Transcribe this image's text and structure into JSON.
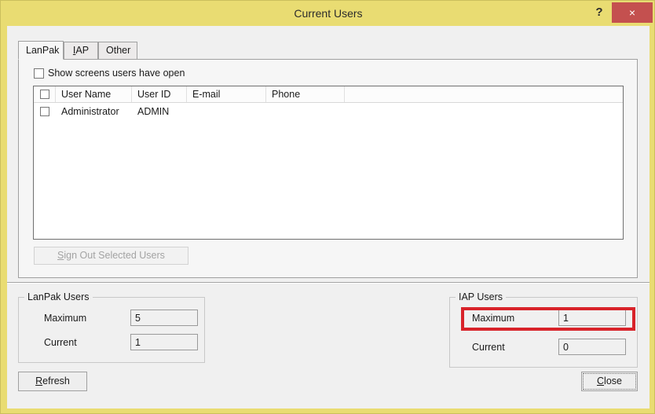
{
  "window": {
    "title": "Current Users",
    "help_label": "?",
    "close_label": "×",
    "frame_color": "#e9dc72",
    "close_button_color": "#c4504f"
  },
  "tabs": [
    {
      "label": "LanPak",
      "active": true
    },
    {
      "label": "IAP",
      "accelerator": "I",
      "active": false
    },
    {
      "label": "Other",
      "active": false
    }
  ],
  "tabpanel": {
    "show_screens": {
      "label": "Show screens users have open",
      "checked": false
    },
    "list": {
      "columns": [
        "",
        "User Name",
        "User ID",
        "E-mail",
        "Phone",
        ""
      ],
      "rows": [
        {
          "checked": false,
          "user_name": "Administrator",
          "user_id": "ADMIN",
          "email": "",
          "phone": ""
        }
      ]
    },
    "sign_out_button": {
      "label": "Sign Out Selected Users",
      "accelerator": "S",
      "enabled": false
    }
  },
  "groups": {
    "lanpak": {
      "legend": "LanPak Users",
      "maximum_label": "Maximum",
      "maximum_value": "5",
      "current_label": "Current",
      "current_value": "1"
    },
    "iap": {
      "legend": "IAP Users",
      "maximum_label": "Maximum",
      "maximum_value": "1",
      "current_label": "Current",
      "current_value": "0"
    }
  },
  "annotation": {
    "color": "#d8232a",
    "target": "IAP Users Maximum"
  },
  "buttons": {
    "refresh": {
      "label": "Refresh",
      "accelerator": "R"
    },
    "close": {
      "label": "Close",
      "accelerator": "C",
      "focused": true
    }
  }
}
